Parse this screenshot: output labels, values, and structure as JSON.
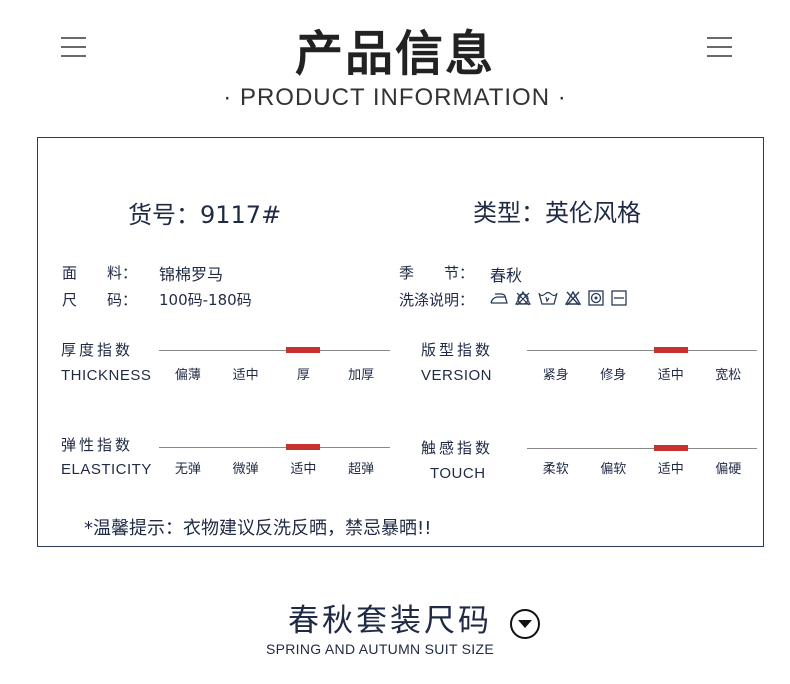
{
  "header": {
    "title_cn": "产品信息",
    "title_en": "· PRODUCT  INFORMATION ·"
  },
  "product": {
    "sku_label": "货号：",
    "sku_value": "9117#",
    "type_label": "类型：",
    "type_value": "英伦风格"
  },
  "specs": {
    "fabric_label": "面　　料：",
    "fabric_value": "锦棉罗马",
    "size_label": "尺　　码：",
    "size_value": "100码-180码",
    "season_label": "季　　节：",
    "season_value": "春秋",
    "care_label": "洗涤说明：",
    "care_icons": [
      "iron-icon",
      "no-bleach-icon",
      "hand-wash-icon",
      "no-dry-clean-icon",
      "tumble-dry-icon",
      "flat-dry-icon"
    ]
  },
  "meters": [
    {
      "title_cn": "厚度指数",
      "title_en": "THICKNESS",
      "ticks": [
        "偏薄",
        "适中",
        "厚",
        "加厚"
      ],
      "selected": "厚"
    },
    {
      "title_cn": "版型指数",
      "title_en": "VERSION",
      "ticks": [
        "紧身",
        "修身",
        "适中",
        "宽松"
      ],
      "selected": "适中"
    },
    {
      "title_cn": "弹性指数",
      "title_en": "ELASTICITY",
      "ticks": [
        "无弹",
        "微弹",
        "适中",
        "超弹"
      ],
      "selected": "适中"
    },
    {
      "title_cn": "触感指数",
      "title_en": "TOUCH",
      "ticks": [
        "柔软",
        "偏软",
        "适中",
        "偏硬"
      ],
      "selected": "适中"
    }
  ],
  "tip": "*温馨提示：衣物建议反洗反晒，禁忌暴晒!!",
  "section": {
    "title_cn": "春秋套装尺码",
    "title_en": "SPRING AND AUTUMN SUIT SIZE"
  },
  "colors": {
    "accent": "#c7322f",
    "text": "#1f2a44",
    "border": "#2a3a5a"
  }
}
